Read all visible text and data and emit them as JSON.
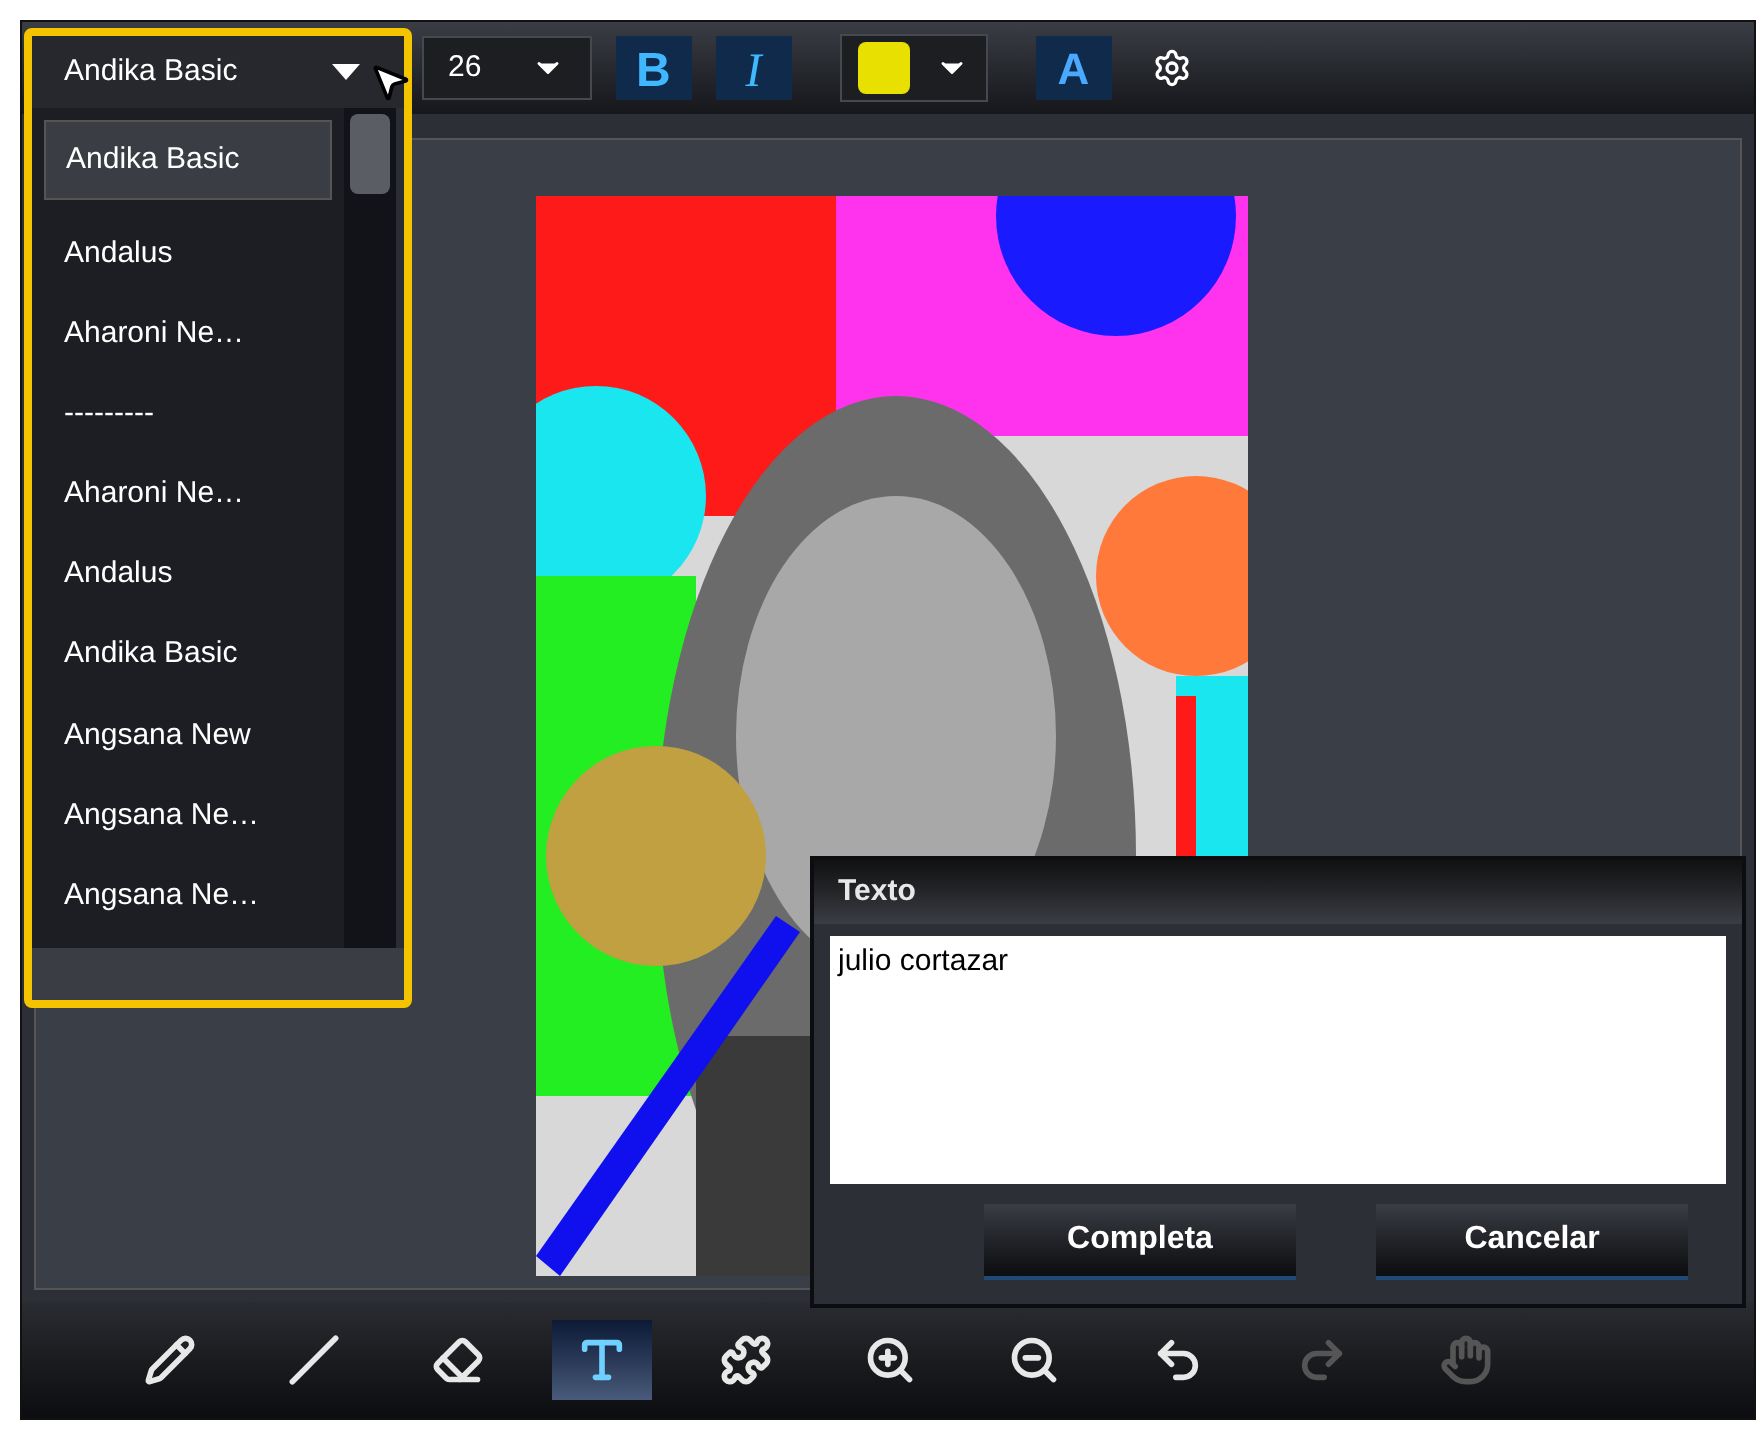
{
  "toolbar": {
    "font": "Andika Basic",
    "size": "26",
    "bold": {
      "label": "B",
      "selected": true
    },
    "italic": {
      "label": "I",
      "selected": true
    },
    "effect": {
      "label": "A"
    },
    "color": "#e8e000"
  },
  "font_list": [
    {
      "label": "Andika Basic",
      "selected": true
    },
    {
      "label": "Andalus",
      "selected": false
    },
    {
      "label": "Aharoni Ne…",
      "selected": false
    },
    {
      "label": "---------",
      "selected": false
    },
    {
      "label": "Aharoni Ne…",
      "selected": false
    },
    {
      "label": "Andalus",
      "selected": false
    },
    {
      "label": "Andika Basic",
      "selected": false
    },
    {
      "label": "Angsana New",
      "selected": false
    },
    {
      "label": "Angsana Ne…",
      "selected": false
    },
    {
      "label": "Angsana Ne…",
      "selected": false
    }
  ],
  "text_dialog": {
    "title": "Texto",
    "value": "julio cortazar",
    "buttons": [
      "Completa",
      "Cancelar"
    ]
  },
  "tools": [
    {
      "kind": "pencil",
      "selected": false,
      "disabled": false
    },
    {
      "kind": "line",
      "selected": false,
      "disabled": false
    },
    {
      "kind": "eraser",
      "selected": false,
      "disabled": false
    },
    {
      "kind": "text",
      "selected": true,
      "disabled": false
    },
    {
      "kind": "shape",
      "selected": false,
      "disabled": false
    },
    {
      "kind": "zoom-in",
      "selected": false,
      "disabled": false
    },
    {
      "kind": "zoom-out",
      "selected": false,
      "disabled": false
    },
    {
      "kind": "undo",
      "selected": false,
      "disabled": false
    },
    {
      "kind": "redo",
      "selected": false,
      "disabled": true
    },
    {
      "kind": "hand",
      "selected": false,
      "disabled": true
    }
  ]
}
